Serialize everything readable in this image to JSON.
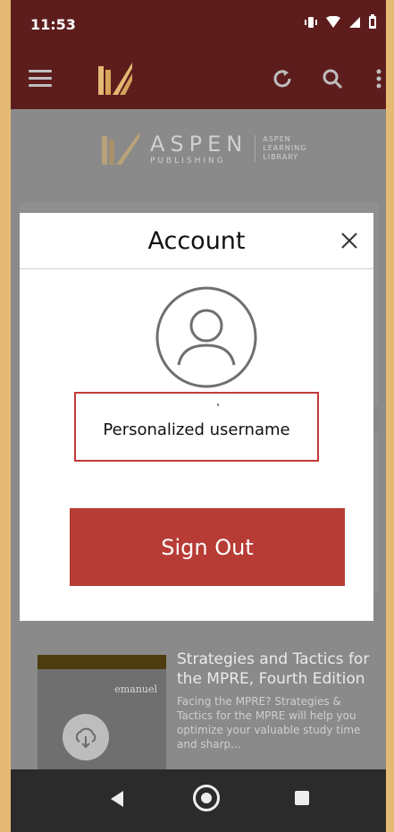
{
  "status_bar": {
    "time": "11:53"
  },
  "brand": {
    "name": "ASPEN",
    "sub": "PUBLISHING",
    "library_line1": "ASPEN",
    "library_line2": "LEARNING",
    "library_line3": "LIBRARY"
  },
  "background_cards": [
    {
      "title_line1": "Strategies and Tactics for",
      "title_line2": "the MPRE, Fourth Edition",
      "description": "Facing the MPRE? Strategies & Tactics for the MPRE will help you optimize your valuable study time and sharp...",
      "cover_brand": "emanuel"
    }
  ],
  "modal": {
    "title": "Account",
    "username": "Personalized username",
    "sign_out_label": "Sign Out"
  },
  "colors": {
    "brand_dark": "#5e1d1d",
    "accent_red": "#b83c36",
    "highlight_border": "#c23a3a"
  }
}
